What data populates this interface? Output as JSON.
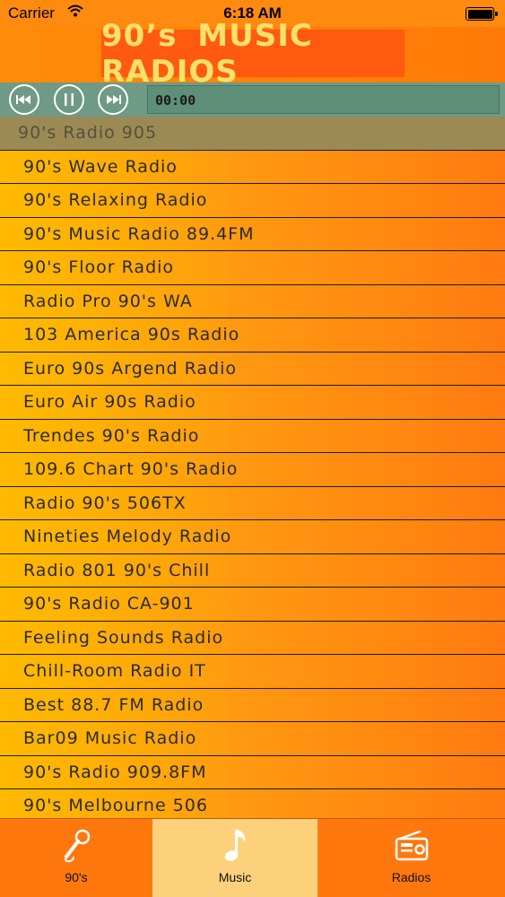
{
  "status_bar": {
    "carrier": "Carrier",
    "time": "6:18 AM",
    "wifi_icon": "wifi-icon",
    "battery_icon": "battery-icon"
  },
  "header": {
    "title": "90’s MUSIC RADIOS"
  },
  "player": {
    "time": "00:00",
    "buttons": [
      "rewind-icon",
      "pause-icon",
      "fast-forward-icon"
    ]
  },
  "stations": [
    "90's Radio 905",
    "90's Wave Radio",
    "90's Relaxing Radio",
    "90's Music Radio 89.4FM",
    "90's Floor Radio",
    "Radio Pro 90's WA",
    "103 America 90s Radio",
    "Euro 90s Argend Radio",
    "Euro Air 90s Radio",
    "Trendes 90's Radio",
    "109.6 Chart 90's Radio",
    "Radio 90's 506TX",
    "Nineties Melody Radio",
    "Radio 801 90's Chill",
    "90's Radio CA-901",
    "Feeling Sounds Radio",
    "Chill-Room Radio IT",
    "Best 88.7 FM Radio",
    "Bar09 Music Radio",
    "90's Radio 909.8FM",
    "90's Melbourne 506"
  ],
  "selected_station_index": 0,
  "tabs": [
    {
      "label": "90's",
      "icon": "microphone-icon",
      "active": false
    },
    {
      "label": "Music",
      "icon": "music-note-icon",
      "active": true
    },
    {
      "label": "Radios",
      "icon": "radio-icon",
      "active": false
    }
  ],
  "colors": {
    "accent": "#ff7a08",
    "banner_bg": "#ff5a10",
    "banner_text": "#ffe06a",
    "player_bg": "#6e9a86",
    "selected_row": "#9c8a55",
    "active_tab": "#fdd17b"
  }
}
